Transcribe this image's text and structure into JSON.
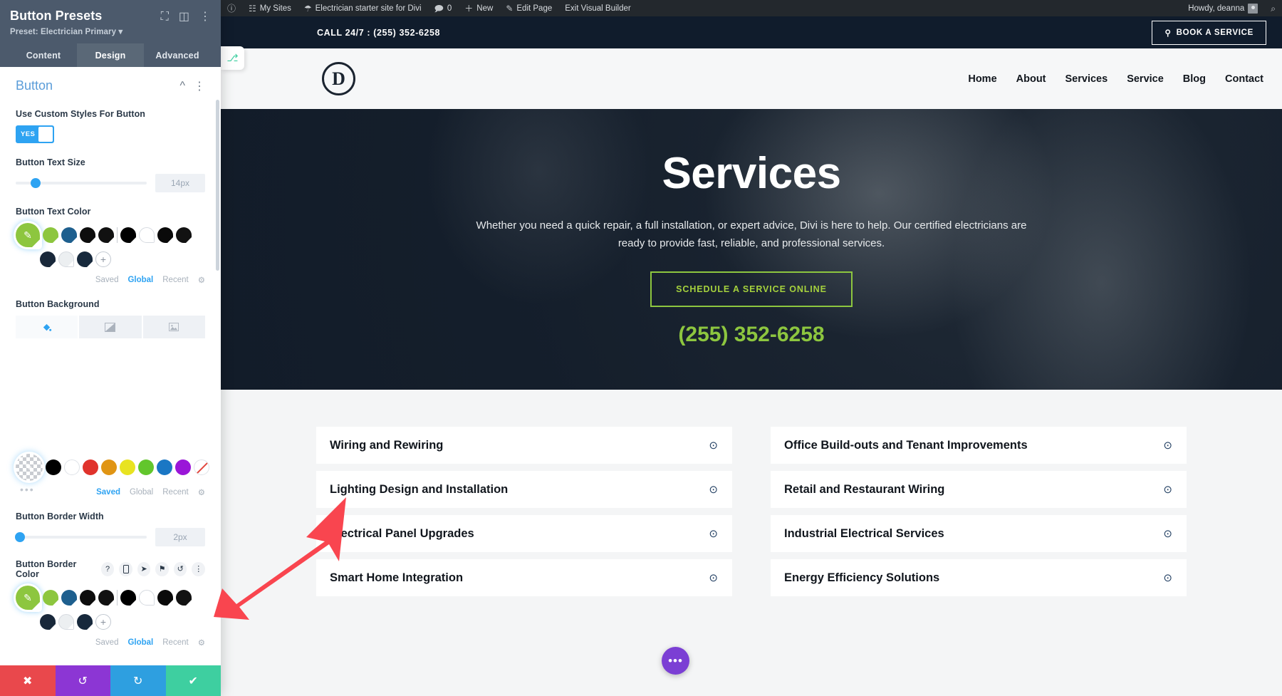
{
  "panel": {
    "title": "Button Presets",
    "preset_label": "Preset: Electrician Primary",
    "preset_caret": "▾",
    "icons": {
      "responsive": "⧉",
      "layout": "▤",
      "more": "⋮"
    },
    "tabs": [
      {
        "label": "Content",
        "active": false
      },
      {
        "label": "Design",
        "active": true
      },
      {
        "label": "Advanced",
        "active": false
      }
    ],
    "section": {
      "title": "Button",
      "collapse_icon": "⌃",
      "more_icon": "⋮"
    },
    "fields": {
      "use_custom_styles": {
        "label": "Use Custom Styles For Button",
        "toggle_value": "YES"
      },
      "button_text_size": {
        "label": "Button Text Size",
        "value": "14px",
        "knob_pct": 15
      },
      "button_text_color": {
        "label": "Button Text Color",
        "selected": "#8dc63f",
        "swatches": [
          "#8dc63f",
          "#1e5f8e",
          "#0d0d0d",
          "#111111",
          "divider",
          "#000000",
          "#ffffff",
          "#0a0a0a",
          "#121212",
          "#19283a",
          "#eceff1",
          "#17293c",
          "add"
        ],
        "picker_tabs": [
          {
            "label": "Saved",
            "active": false
          },
          {
            "label": "Global",
            "active": true
          },
          {
            "label": "Recent",
            "active": false
          }
        ],
        "settings_icon": "⚙"
      },
      "button_background": {
        "label": "Button Background",
        "types": [
          {
            "name": "color-fill-icon",
            "glyph": "◢",
            "active": true
          },
          {
            "name": "gradient-icon",
            "glyph": "◧",
            "active": false
          },
          {
            "name": "image-icon",
            "glyph": "Ὓc",
            "active": false
          }
        ],
        "palette": [
          "#000000",
          "#ffffff",
          "#e0332c",
          "#e09514",
          "#e8e321",
          "#62c62c",
          "#1a77c4",
          "#9a16d8",
          "none"
        ],
        "selected": "transparent",
        "picker_tabs": [
          {
            "label": "Saved",
            "active": true
          },
          {
            "label": "Global",
            "active": false
          },
          {
            "label": "Recent",
            "active": false
          }
        ],
        "settings_icon": "⚙",
        "more_dots": "•••"
      },
      "button_border_width": {
        "label": "Button Border Width",
        "value": "2px",
        "knob_pct": 2
      },
      "button_border_color": {
        "label": "Button Border Color",
        "selected": "#8dc63f",
        "tool_icons": [
          "?",
          "▯",
          "➤",
          "⚑",
          "↺",
          "⋮"
        ],
        "swatches": [
          "#8dc63f",
          "#1e5f8e",
          "#0d0d0d",
          "#111111",
          "divider",
          "#000000",
          "#ffffff",
          "#0a0a0a",
          "#121212",
          "#19283a",
          "#eceff1",
          "#17293c",
          "add"
        ],
        "picker_tabs": [
          {
            "label": "Saved",
            "active": false
          },
          {
            "label": "Global",
            "active": true
          },
          {
            "label": "Recent",
            "active": false
          }
        ]
      }
    },
    "actions": [
      {
        "name": "cancel",
        "glyph": "✖",
        "color": "#e9484c"
      },
      {
        "name": "undo",
        "glyph": "↺",
        "color": "#8c36d4"
      },
      {
        "name": "redo",
        "glyph": "↻",
        "color": "#2e9fe0"
      },
      {
        "name": "save",
        "glyph": "✔",
        "color": "#3ecfa0"
      }
    ]
  },
  "admin_bar": {
    "items": [
      {
        "name": "wordpress-logo",
        "icon": "Ⓦ",
        "label": ""
      },
      {
        "name": "my-sites",
        "icon": "⚙",
        "label": "My Sites"
      },
      {
        "name": "site-name",
        "icon": "⌂",
        "label": "Electrician starter site for Divi"
      },
      {
        "name": "comments",
        "icon": "὞9",
        "label": "0"
      },
      {
        "name": "new-content",
        "icon": "＋",
        "label": "New"
      },
      {
        "name": "edit-page",
        "icon": "✎",
        "label": "Edit Page"
      },
      {
        "name": "exit-visual-builder",
        "icon": "",
        "label": "Exit Visual Builder"
      }
    ],
    "howdy": "Howdy, deanna",
    "search_icon": "⌕"
  },
  "site": {
    "topbar": {
      "phone_text": "CALL 24/7 : (255) 352-6258",
      "book_button": "BOOK A SERVICE",
      "book_icon": "⚲"
    },
    "logo_letter": "D",
    "nav": [
      "Home",
      "About",
      "Services",
      "Service",
      "Blog",
      "Contact"
    ],
    "hero": {
      "title": "Services",
      "subtitle": "Whether you need a quick repair, a full installation, or expert advice, Divi is here to help. Our certified electricians are ready to provide fast, reliable, and professional services.",
      "cta": "SCHEDULE A SERVICE ONLINE",
      "phone": "(255) 352-6258"
    },
    "services": {
      "toggle_icon": "⊙",
      "left": [
        "Wiring and Rewiring",
        "Lighting Design and Installation",
        "Electrical Panel Upgrades",
        "Smart Home Integration"
      ],
      "right": [
        "Office Build-outs and Tenant Improvements",
        "Retail and Restaurant Wiring",
        "Industrial Electrical Services",
        "Energy Efficiency Solutions"
      ]
    },
    "fab_icon": "•••",
    "side_tab_icon": "⎇"
  }
}
